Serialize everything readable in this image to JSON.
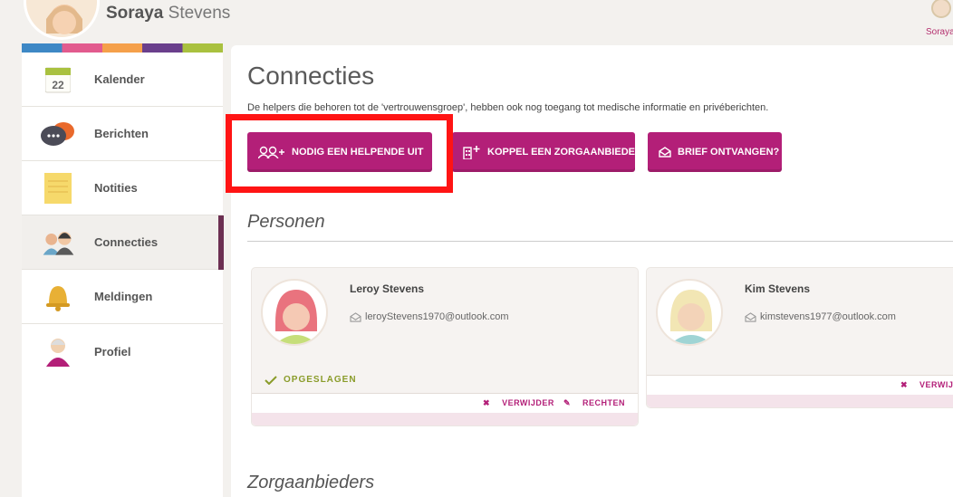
{
  "header": {
    "first_name": "Soraya",
    "last_name": " Stevens",
    "corner_name": "Soraya"
  },
  "sidebar": {
    "items": [
      {
        "label": "Kalender",
        "icon": "calendar-icon",
        "badge": "22"
      },
      {
        "label": "Berichten",
        "icon": "chat-icon"
      },
      {
        "label": "Notities",
        "icon": "note-icon"
      },
      {
        "label": "Connecties",
        "icon": "people-icon",
        "active": true
      },
      {
        "label": "Meldingen",
        "icon": "bell-icon"
      },
      {
        "label": "Profiel",
        "icon": "profile-icon"
      }
    ]
  },
  "main": {
    "title": "Connecties",
    "description": "De helpers die behoren tot de 'vertrouwensgroep', hebben ook nog toegang tot medische informatie en privéberichten.",
    "buttons": {
      "invite": "NODIG EEN HELPENDE UIT",
      "link_provider": "KOPPEL EEN ZORGAANBIEDER",
      "letter": "BRIEF ONTVANGEN?"
    },
    "sections": {
      "persons": "Personen",
      "providers": "Zorgaanbieders"
    },
    "persons": [
      {
        "name": "Leroy Stevens",
        "email": "leroyStevens1970@outlook.com",
        "status": "OPGESLAGEN",
        "remove": "VERWIJDER",
        "rights": "RECHTEN"
      },
      {
        "name": "Kim Stevens",
        "email": "kimstevens1977@outlook.com",
        "remove": "VERWIJDER"
      }
    ]
  },
  "colors": {
    "accent": "#b31f78",
    "highlight": "#ff1414",
    "saved": "#8a9c2a"
  }
}
